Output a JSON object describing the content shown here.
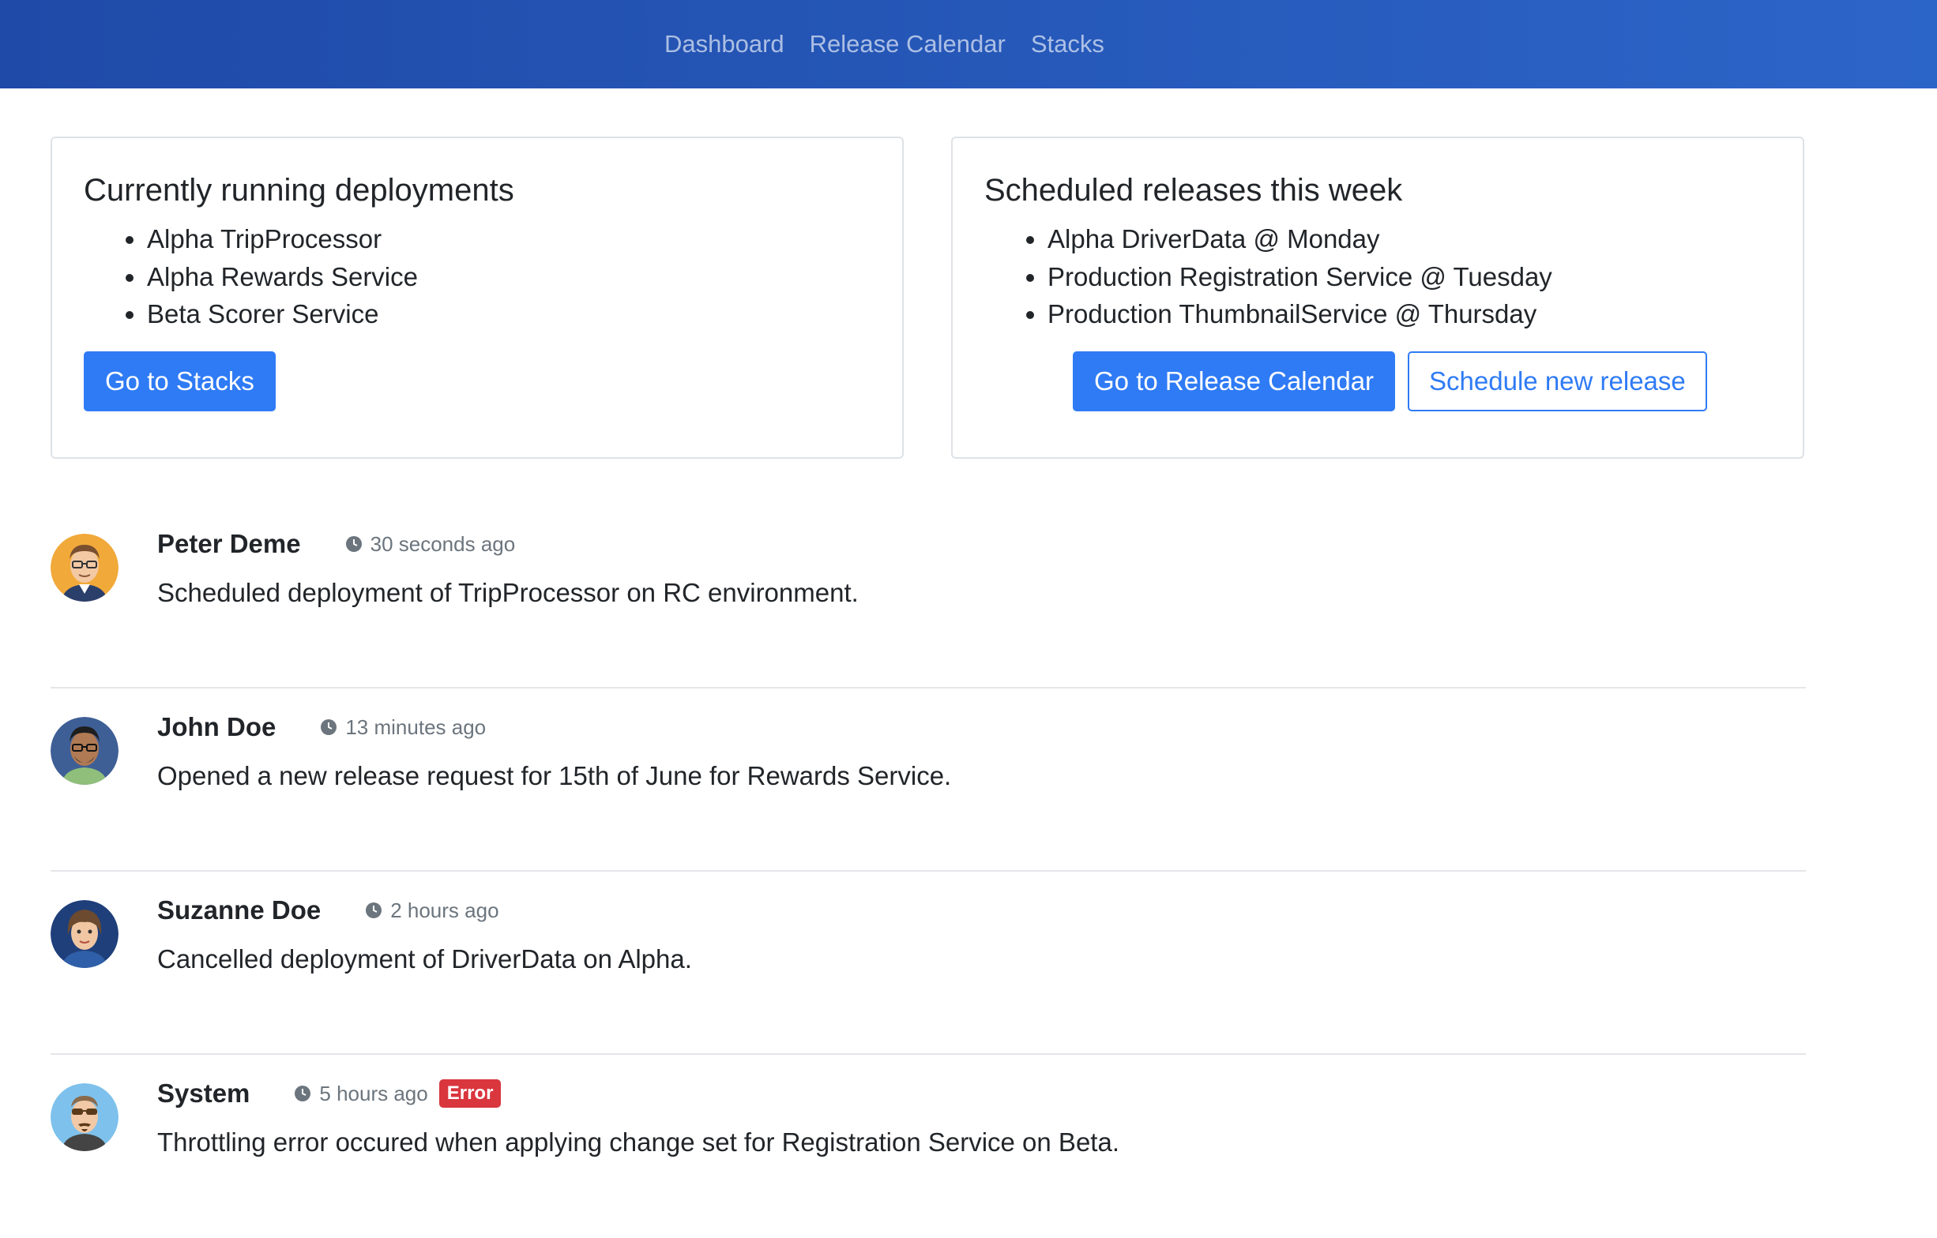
{
  "nav": {
    "items": [
      {
        "label": "Dashboard"
      },
      {
        "label": "Release Calendar"
      },
      {
        "label": "Stacks"
      }
    ]
  },
  "running": {
    "title": "Currently running deployments",
    "items": [
      "Alpha TripProcessor",
      "Alpha Rewards Service",
      "Beta Scorer Service"
    ],
    "button": "Go to Stacks"
  },
  "scheduled": {
    "title": "Scheduled releases this week",
    "items": [
      "Alpha DriverData @ Monday",
      "Production Registration Service @ Tuesday",
      "Production ThumbnailService @ Thursday"
    ],
    "primary_button": "Go to Release Calendar",
    "secondary_button": "Schedule new release"
  },
  "feed": [
    {
      "name": "Peter Deme",
      "time": "30 seconds ago",
      "text": "Scheduled deployment of TripProcessor on RC environment.",
      "avatar": "man-glasses-avatar"
    },
    {
      "name": "John Doe",
      "time": "13 minutes ago",
      "text": "Opened a new release request for 15th of June for Rewards Service.",
      "avatar": "man-beard-avatar"
    },
    {
      "name": "Suzanne Doe",
      "time": "2 hours ago",
      "text": "Cancelled deployment of DriverData on Alpha.",
      "avatar": "woman-avatar"
    },
    {
      "name": "System",
      "time": "5 hours ago",
      "text": "Throttling error occured when applying change set for Registration Service on Beta.",
      "badge": "Error",
      "avatar": "man-sunglasses-avatar"
    }
  ],
  "colors": {
    "navbar_start": "#1f4aa8",
    "navbar_end": "#2c65c8",
    "primary": "#2f7bf5",
    "error": "#d9363e",
    "muted": "#6c757d"
  }
}
